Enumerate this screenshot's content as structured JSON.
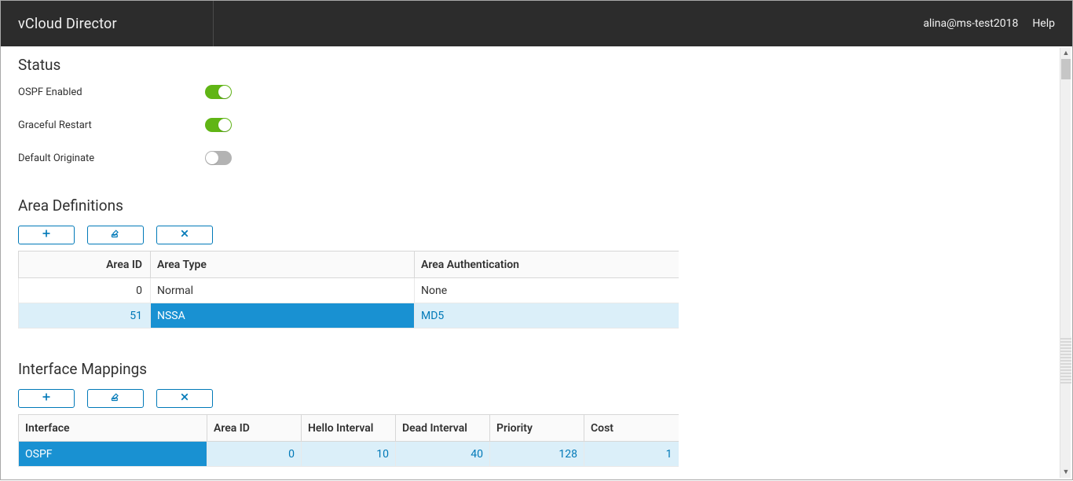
{
  "header": {
    "title": "vCloud Director",
    "user": "alina@ms-test2018",
    "help": "Help"
  },
  "status": {
    "heading": "Status",
    "ospf_enabled": {
      "label": "OSPF Enabled",
      "value": true
    },
    "graceful_restart": {
      "label": "Graceful Restart",
      "value": true
    },
    "default_originate": {
      "label": "Default Originate",
      "value": false
    }
  },
  "area": {
    "heading": "Area Definitions",
    "columns": [
      "Area ID",
      "Area Type",
      "Area Authentication"
    ],
    "rows": [
      {
        "id": "0",
        "type": "Normal",
        "auth": "None",
        "selected": false
      },
      {
        "id": "51",
        "type": "NSSA",
        "auth": "MD5",
        "selected": true
      }
    ]
  },
  "ifmap": {
    "heading": "Interface Mappings",
    "columns": [
      "Interface",
      "Area ID",
      "Hello Interval",
      "Dead Interval",
      "Priority",
      "Cost"
    ],
    "rows": [
      {
        "interface": "OSPF",
        "area_id": "0",
        "hello": "10",
        "dead": "40",
        "priority": "128",
        "cost": "1",
        "selected": true
      }
    ]
  },
  "icons": {
    "add": "add-icon",
    "edit": "edit-icon",
    "delete": "delete-icon"
  }
}
